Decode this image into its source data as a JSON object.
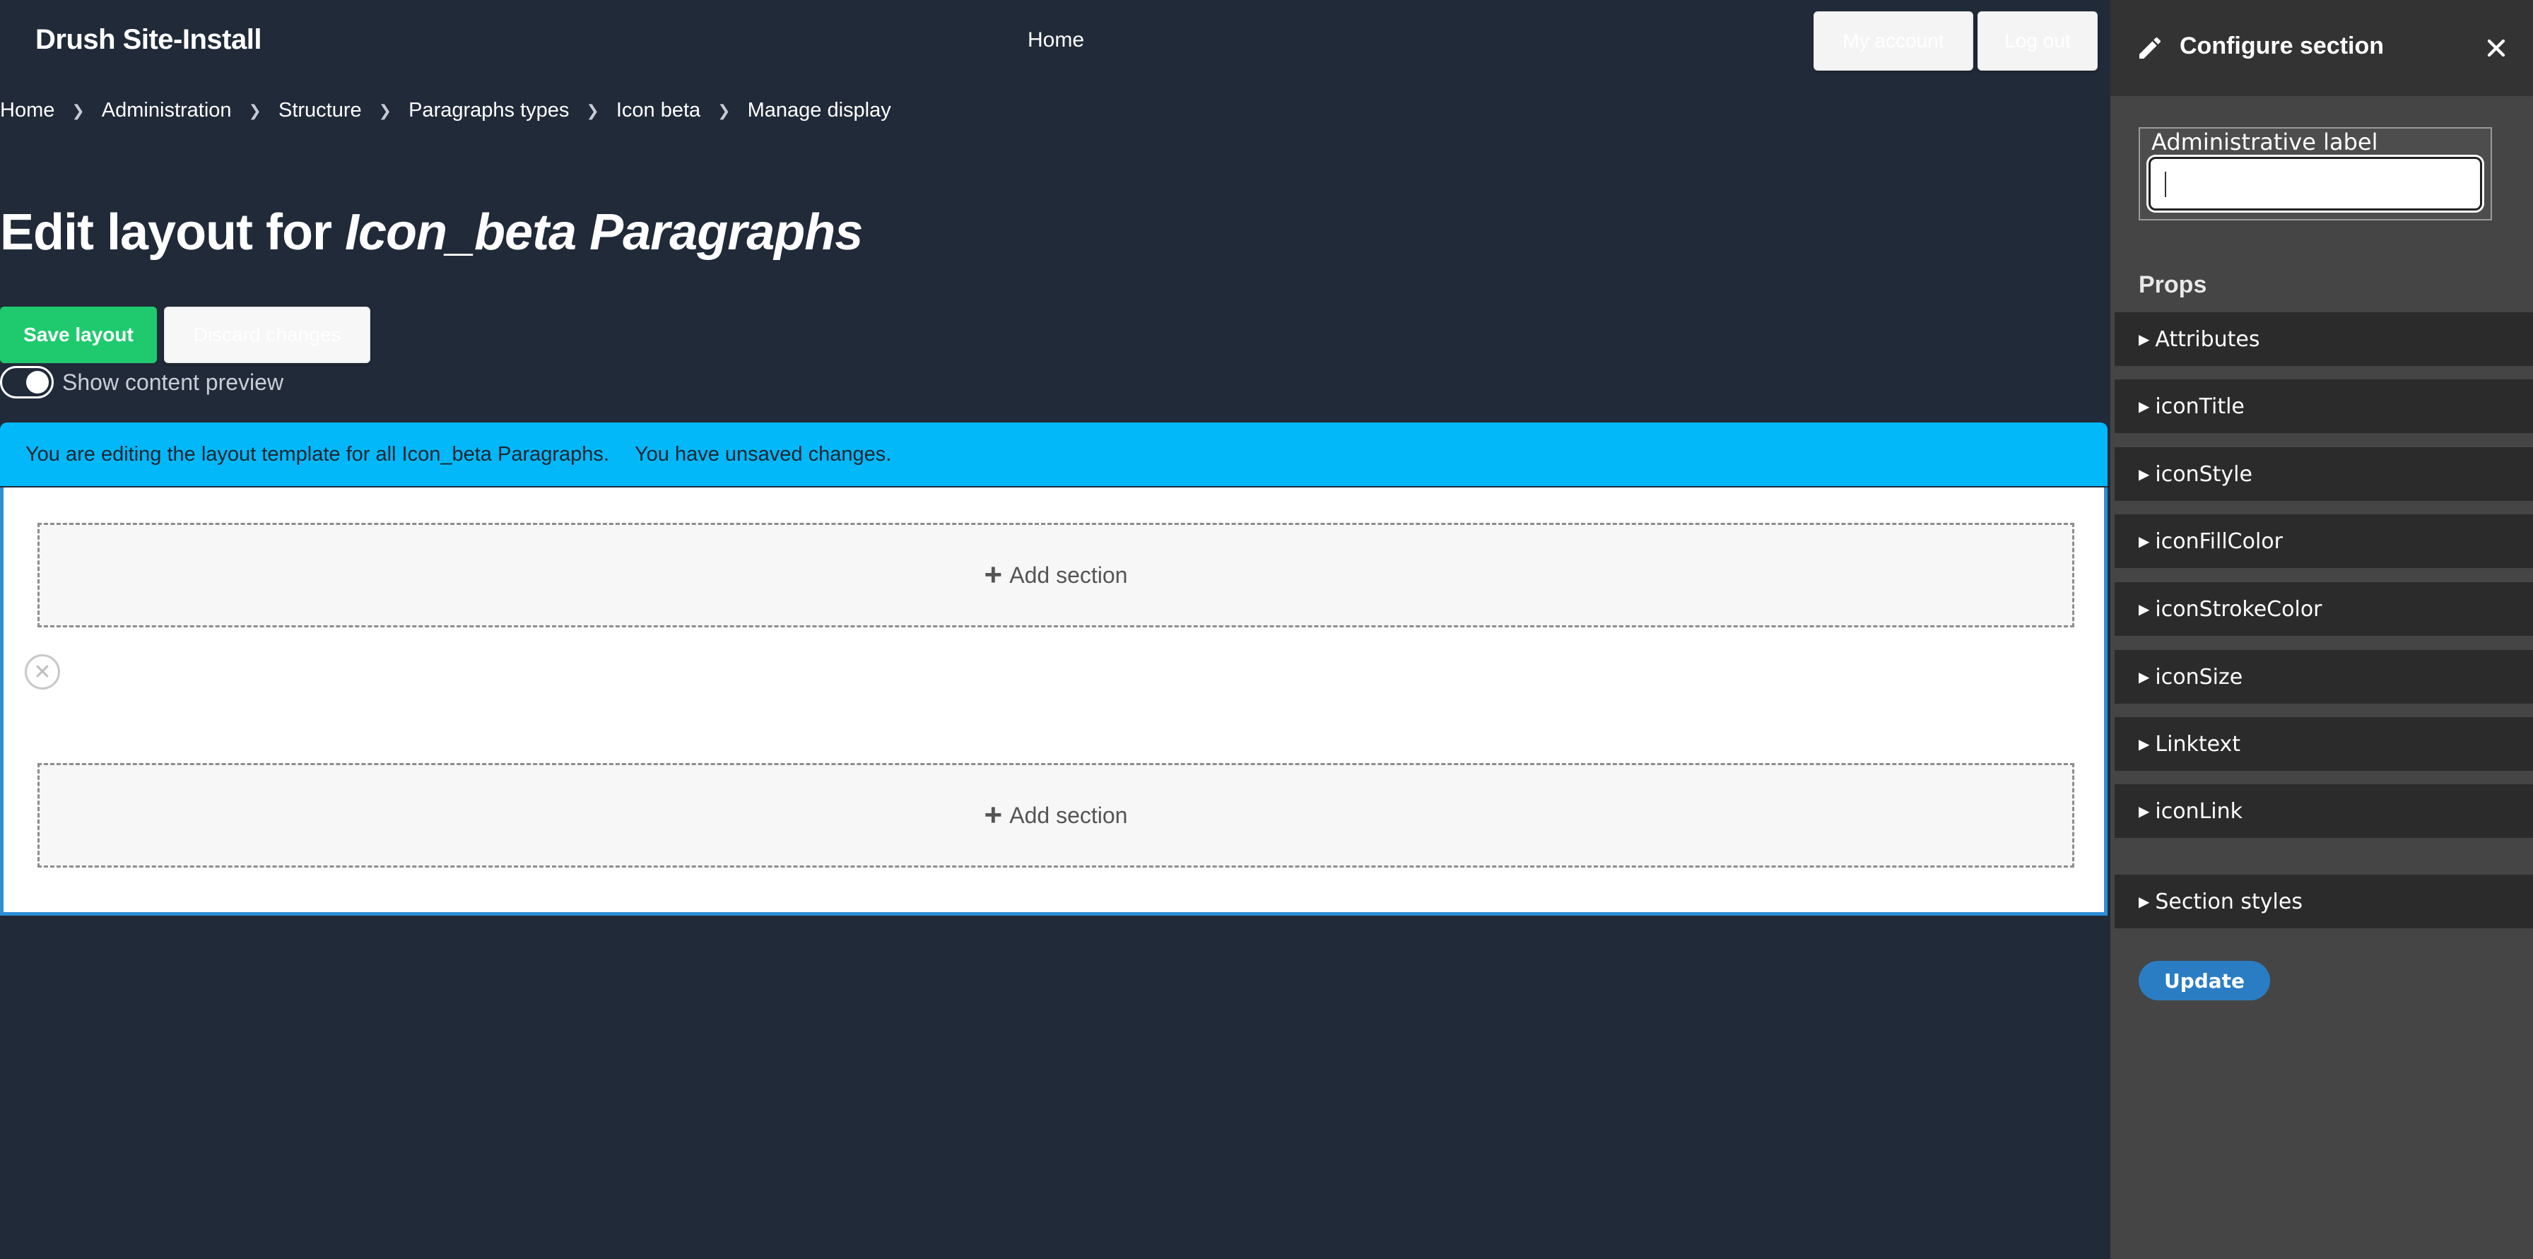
{
  "header": {
    "site_title": "Drush Site-Install",
    "nav_home": "Home",
    "my_account": "My account",
    "log_out": "Log out"
  },
  "breadcrumb": [
    "Home",
    "Administration",
    "Structure",
    "Paragraphs types",
    "Icon beta",
    "Manage display"
  ],
  "page": {
    "title_prefix": "Edit layout for ",
    "title_entity": "Icon_beta Paragraphs",
    "save_label": "Save layout",
    "discard_label": "Discard changes",
    "preview_label": "Show content preview",
    "preview_enabled": true
  },
  "message": {
    "editing_text": "You are editing the layout template for all Icon_beta Paragraphs.",
    "unsaved_text": "You have unsaved changes."
  },
  "layout": {
    "add_section_label": "Add section",
    "remove_section_icon": "close-circle-icon"
  },
  "sidebar": {
    "title": "Configure section",
    "header_icon": "pencil-icon",
    "close_icon": "close-icon",
    "admin_label": "Administrative label",
    "admin_value": "",
    "props_heading": "Props",
    "props": [
      "Attributes",
      "iconTitle",
      "iconStyle",
      "iconFillColor",
      "iconStrokeColor",
      "iconSize",
      "Linktext",
      "iconLink"
    ],
    "section_styles": "Section styles",
    "update_label": "Update"
  },
  "colors": {
    "page_bg": "#212a39",
    "save_green": "#1fca6e",
    "message_blue": "#03b8f9",
    "canvas_border": "#2d8ed6",
    "sidebar_bg": "#454545",
    "update_blue": "#2a7dc3"
  }
}
